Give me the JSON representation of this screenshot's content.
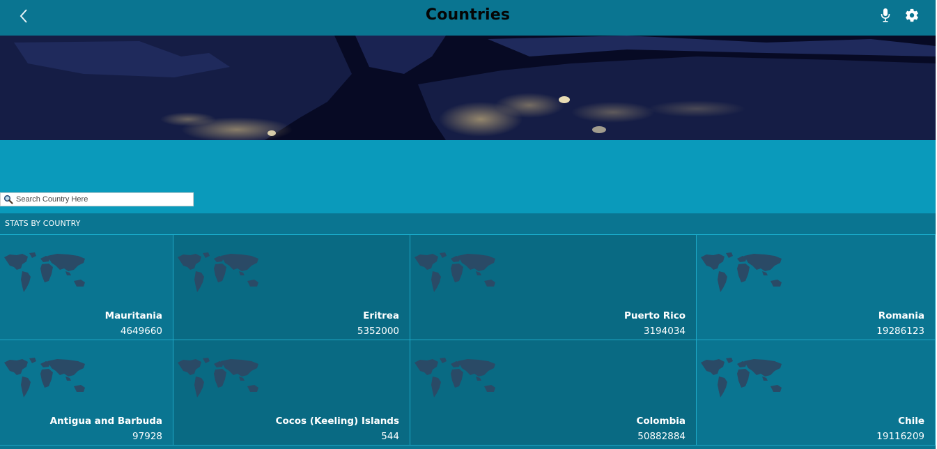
{
  "header": {
    "title": "Countries",
    "background": "#0a7591",
    "icons": {
      "back": "chevron-left-icon",
      "mic": "microphone-icon",
      "settings": "gear-icon"
    }
  },
  "banner": {
    "description": "night-earth-lights",
    "background": "#070a24"
  },
  "search": {
    "placeholder": "Search Country Here",
    "value": "",
    "icon": "search-icon"
  },
  "section": {
    "label": "STATS BY COUNTRY"
  },
  "countries": [
    {
      "name": "Mauritania",
      "population": "4649660"
    },
    {
      "name": "Eritrea",
      "population": "5352000"
    },
    {
      "name": "Puerto Rico",
      "population": "3194034"
    },
    {
      "name": "Romania",
      "population": "19286123"
    },
    {
      "name": "Antigua and Barbuda",
      "population": "97928"
    },
    {
      "name": "Cocos (Keeling) Islands",
      "population": "544"
    },
    {
      "name": "Colombia",
      "population": "50882884"
    },
    {
      "name": "Chile",
      "population": "19116209"
    }
  ],
  "colors": {
    "accent": "#0a9abb",
    "tile_dark": "#096a83",
    "tile_light": "#0a7591",
    "divider": "#1ea8c7"
  }
}
